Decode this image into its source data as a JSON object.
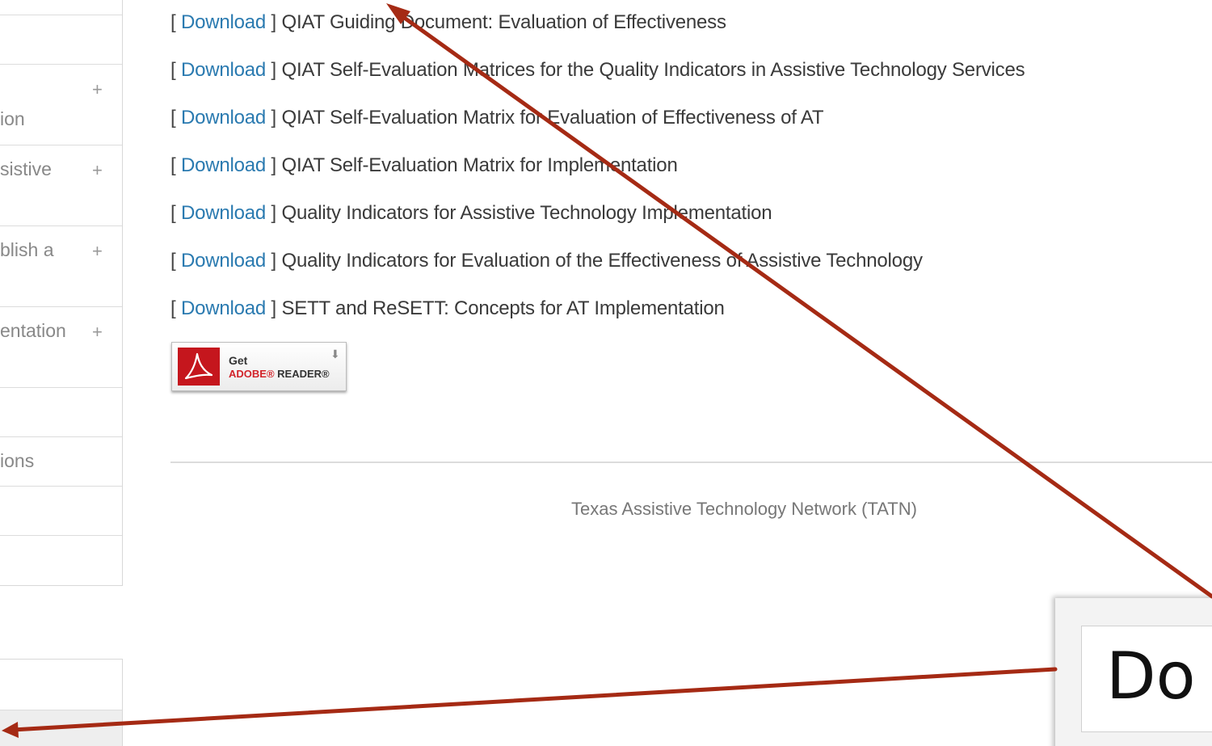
{
  "sidebar": {
    "items": [
      {
        "label": "",
        "plus": ""
      },
      {
        "label": "ion",
        "plus": "+"
      },
      {
        "label": "sistive",
        "plus": "+"
      },
      {
        "label": "blish a",
        "plus": "+"
      },
      {
        "label": "entation",
        "plus": "+"
      },
      {
        "label": "",
        "plus": ""
      },
      {
        "label": "ions",
        "plus": ""
      },
      {
        "label": "",
        "plus": ""
      },
      {
        "label": "",
        "plus": ""
      }
    ]
  },
  "documents": {
    "bracket_open": "[",
    "bracket_close": "]",
    "download_label": "Download",
    "items": [
      {
        "title": "QIAT Guiding Document: Evaluation of Effectiveness"
      },
      {
        "title": "QIAT Self-Evaluation Matrices for the Quality Indicators in Assistive Technology Services"
      },
      {
        "title": "QIAT Self-Evaluation Matrix for Evaluation of Effectiveness of AT"
      },
      {
        "title": "QIAT Self-Evaluation Matrix for Implementation"
      },
      {
        "title": "Quality Indicators for Assistive Technology Implementation"
      },
      {
        "title": "Quality Indicators for Evaluation of the Effectiveness of Assistive Technology"
      },
      {
        "title": "SETT and ReSETT: Concepts for AT Implementation"
      }
    ]
  },
  "adobe_badge": {
    "get": "Get",
    "brand": "ADOBE®",
    "product": "READER®",
    "icon": "download-arrow-icon"
  },
  "footer": {
    "text": "Texas Assistive Technology Network (TATN)"
  },
  "callout": {
    "zoom_text": "Do"
  },
  "colors": {
    "link": "#2a7ab0",
    "annotation_arrow": "#a52a14",
    "adobe_red": "#c5161d"
  }
}
